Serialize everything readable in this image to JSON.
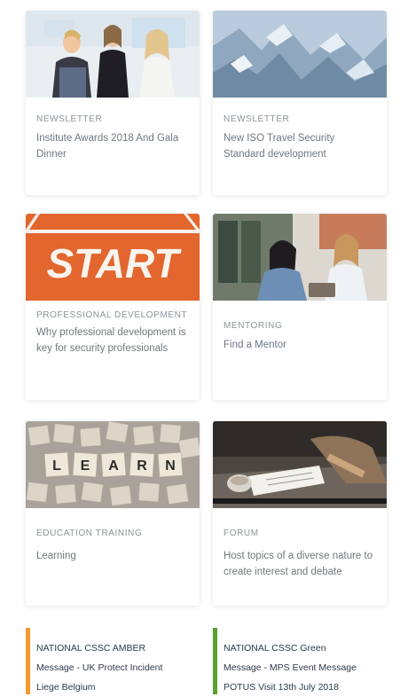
{
  "cards": [
    {
      "category": "NEWSLETTER",
      "title": "Institute Awards 2018 And Gala Dinner"
    },
    {
      "category": "NEWSLETTER",
      "title": "New ISO Travel Security Standard development"
    },
    {
      "category": "PROFESSIONAL DEVELOPMENT",
      "title": "Why professional development is key for security professionals",
      "image_text": "START"
    },
    {
      "category": "MENTORING",
      "title": "Find a Mentor"
    },
    {
      "category": "EDUCATION TRAINING",
      "title": "Learning",
      "image_tiles": [
        "L",
        "E",
        "A",
        "R",
        "N"
      ]
    },
    {
      "category": "FORUM",
      "title": "Host topics of a diverse nature to create interest and debate"
    }
  ],
  "alerts": [
    {
      "color": "#f39a2e",
      "lines": [
        "NATIONAL CSSC AMBER",
        "Message - UK Protect Incident",
        "Liege Belgium"
      ]
    },
    {
      "color": "#5aa02c",
      "lines": [
        "NATIONAL CSSC Green",
        "Message - MPS Event Message",
        "POTUS Visit 13th July 2018"
      ]
    }
  ],
  "colors": {
    "start_orange": "#e2662e",
    "card_shadow": "rgba(0,0,0,0.10)",
    "category_text": "#8c939b",
    "title_text": "#707780",
    "alert_text": "#2d3a4a"
  }
}
